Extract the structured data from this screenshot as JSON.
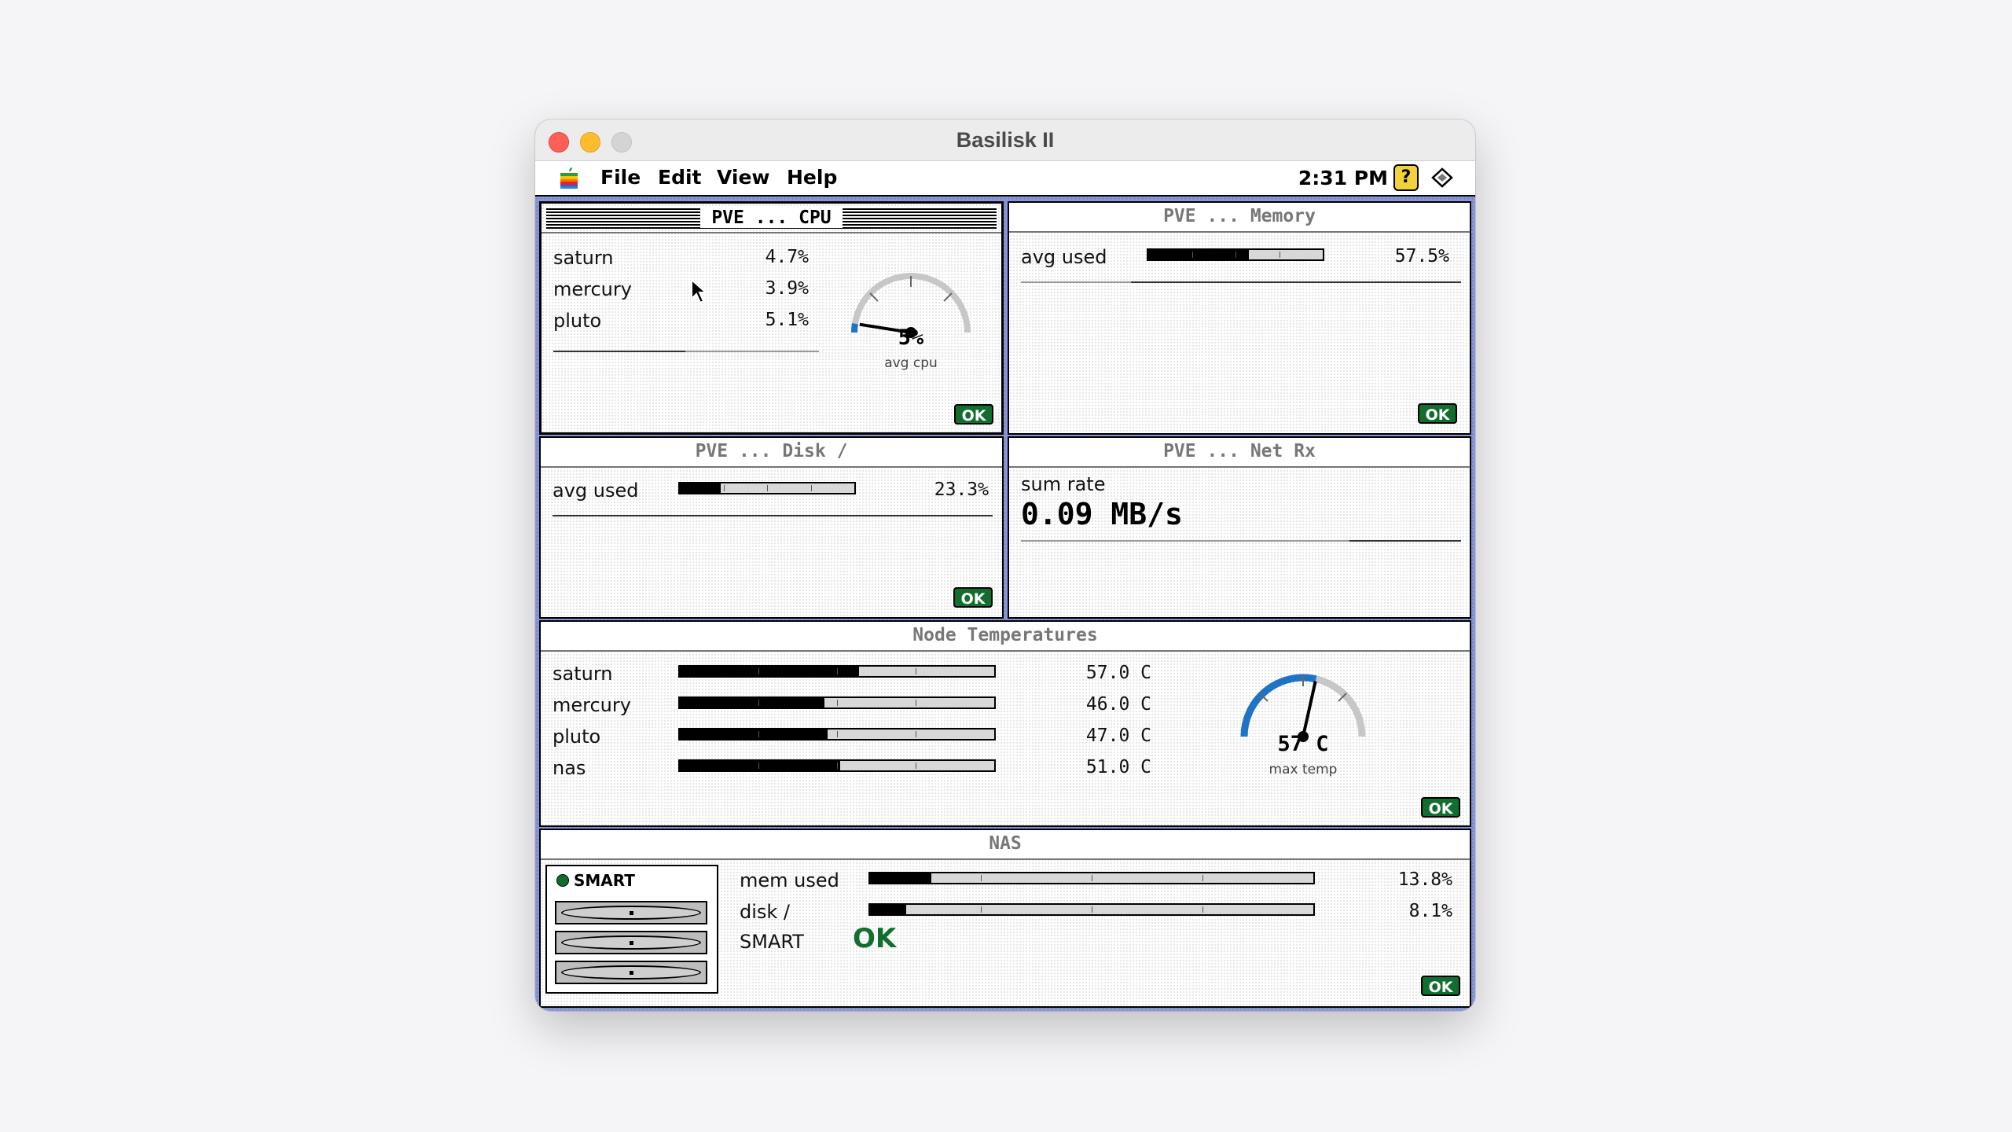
{
  "window": {
    "title": "Basilisk II"
  },
  "menubar": {
    "items": [
      "File",
      "Edit",
      "View",
      "Help"
    ],
    "clock": "2:31 PM",
    "icons": [
      "apple-icon",
      "help-icon",
      "finder-icon"
    ]
  },
  "cpu": {
    "title": "PVE ... CPU",
    "rows": [
      {
        "name": "saturn",
        "value": "4.7%"
      },
      {
        "name": "mercury",
        "value": "3.9%"
      },
      {
        "name": "pluto",
        "value": "5.1%"
      }
    ],
    "gauge": {
      "value": "5%",
      "label": "avg cpu",
      "fraction": 0.05
    },
    "ok": "OK"
  },
  "memory": {
    "title": "PVE ... Memory",
    "label": "avg used",
    "value": "57.5%",
    "fraction": 0.575,
    "ok": "OK"
  },
  "disk": {
    "title": "PVE ... Disk /",
    "label": "avg used",
    "value": "23.3%",
    "fraction": 0.233,
    "ok": "OK"
  },
  "net": {
    "title": "PVE ... Net Rx",
    "label": "sum rate",
    "value": "0.09 MB/s"
  },
  "temps": {
    "title": "Node Temperatures",
    "rows": [
      {
        "name": "saturn",
        "value": "57.0 C",
        "fraction": 0.57
      },
      {
        "name": "mercury",
        "value": "46.0 C",
        "fraction": 0.46
      },
      {
        "name": "pluto",
        "value": "47.0 C",
        "fraction": 0.47
      },
      {
        "name": "nas",
        "value": "51.0 C",
        "fraction": 0.51
      }
    ],
    "gauge": {
      "value": "57 C",
      "label": "max temp",
      "fraction": 0.57
    },
    "ok": "OK"
  },
  "nas": {
    "title": "NAS",
    "badge": "SMART",
    "rows": [
      {
        "name": "mem used",
        "value": "13.8%",
        "fraction": 0.138
      },
      {
        "name": "disk /",
        "value": "8.1%",
        "fraction": 0.081
      }
    ],
    "smart_label": "SMART",
    "smart_value": "OK",
    "ok": "OK"
  },
  "colors": {
    "ok_green": "#116e2e",
    "desktop": "#8b97d6",
    "gauge_blue": "#1f73c7"
  }
}
